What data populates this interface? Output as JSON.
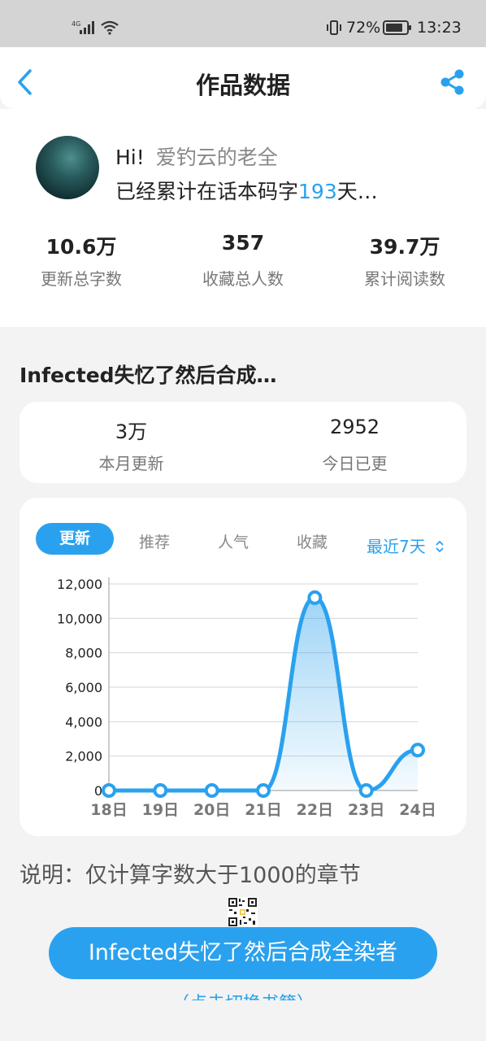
{
  "status_bar": {
    "network": "4G",
    "battery_percent": "72%",
    "time": "13:23"
  },
  "header": {
    "title": "作品数据"
  },
  "profile": {
    "greeting": "Hi!",
    "username": "爱钓云的老全",
    "streak_prefix": "已经累计在话本码字",
    "streak_days": "193",
    "streak_suffix": "天…",
    "stats": [
      {
        "value": "10.6万",
        "label": "更新总字数"
      },
      {
        "value": "357",
        "label": "收藏总人数"
      },
      {
        "value": "39.7万",
        "label": "累计阅读数"
      }
    ]
  },
  "work": {
    "title": "Infected失忆了然后合成…",
    "updates": [
      {
        "value": "3万",
        "label": "本月更新"
      },
      {
        "value": "2952",
        "label": "今日已更"
      }
    ]
  },
  "chart_tabs": {
    "items": [
      "更新",
      "推荐",
      "人气",
      "收藏"
    ],
    "active": "更新",
    "range_label": "最近7天"
  },
  "chart_data": {
    "type": "area",
    "categories": [
      "18日",
      "19日",
      "20日",
      "21日",
      "22日",
      "23日",
      "24日"
    ],
    "values": [
      0,
      0,
      0,
      0,
      11200,
      0,
      2350
    ],
    "ylim": [
      0,
      12000
    ],
    "yticks": [
      "0",
      "2,000",
      "4,000",
      "6,000",
      "8,000",
      "10,000",
      "12,000"
    ],
    "grid": true,
    "color": "#2aa1ee"
  },
  "note": "说明：仅计算字数大于1000的章节",
  "book_button": "Infected失忆了然后合成全染者",
  "switch_link": "（点击切换书籍）"
}
